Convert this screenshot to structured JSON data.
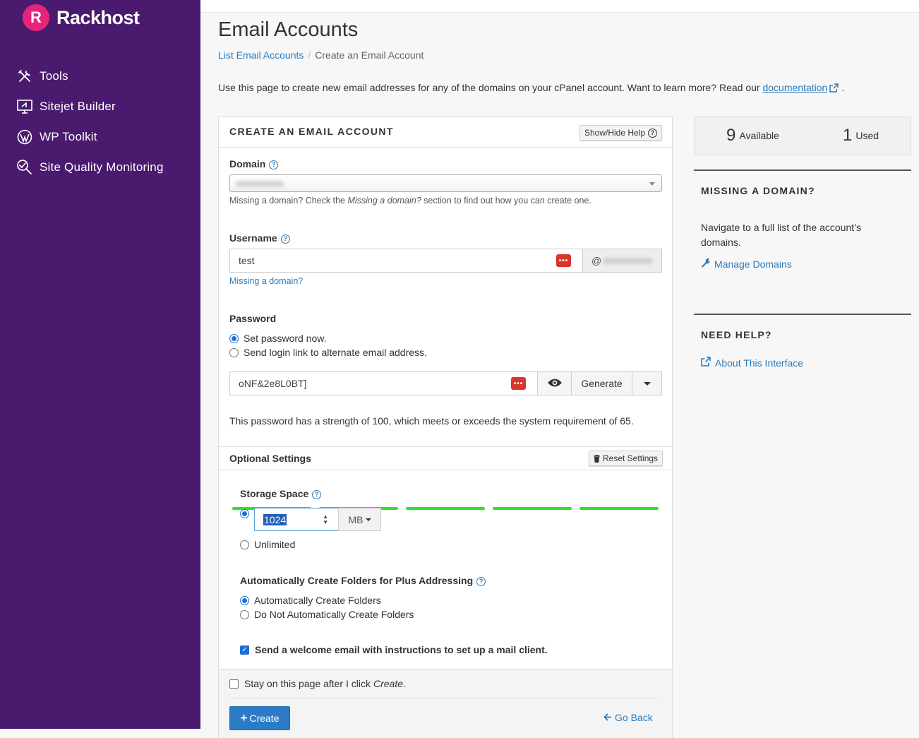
{
  "brand": {
    "mark": "R",
    "name": "Rackhost",
    "mark_color": "#e8247a",
    "sidebar_color": "#4a1a6e"
  },
  "nav": [
    {
      "label": "Tools",
      "icon": "tools-icon"
    },
    {
      "label": "Sitejet Builder",
      "icon": "sitejet-monitor-icon"
    },
    {
      "label": "WP Toolkit",
      "icon": "wordpress-icon"
    },
    {
      "label": "Site Quality Monitoring",
      "icon": "magnifier-icon"
    }
  ],
  "page": {
    "title": "Email Accounts",
    "breadcrumb": {
      "parent": "List Email Accounts",
      "current": "Create an Email Account"
    },
    "intro_text": "Use this page to create new email addresses for any of the domains on your cPanel account. Want to learn more? Read our",
    "intro_link": "documentation",
    "intro_end": "."
  },
  "form": {
    "title": "CREATE AN EMAIL ACCOUNT",
    "help_toggle": "Show/Hide Help",
    "domain": {
      "label": "Domain",
      "hint_prefix": "Missing a domain? Check the",
      "hint_em": "Missing a domain?",
      "hint_suffix": "section to find out how you can create one."
    },
    "username": {
      "label": "Username",
      "value": "test",
      "at": "@",
      "missing_link": "Missing a domain?"
    },
    "password": {
      "label": "Password",
      "option_now": "Set password now.",
      "option_link": "Send login link to alternate email address.",
      "value": "oNF&2e8L0BT]",
      "generate": "Generate",
      "strength_text": "This password has a strength of 100, which meets or exceeds the system requirement of 65.",
      "strength": 100,
      "strength_color": "#2ee02e"
    },
    "optional": {
      "title": "Optional Settings",
      "reset": "Reset Settings",
      "storage_label": "Storage Space",
      "storage_value": "1024",
      "storage_unit": "MB",
      "unlimited": "Unlimited",
      "plus_label": "Automatically Create Folders for Plus Addressing",
      "plus_auto": "Automatically Create Folders",
      "plus_no": "Do Not Automatically Create Folders",
      "welcome": "Send a welcome email with instructions to set up a mail client."
    },
    "footer": {
      "stay_prefix": "Stay on this page after I click",
      "stay_em": "Create",
      "stay_suffix": ".",
      "create": "Create",
      "go_back": "Go Back"
    }
  },
  "stats": {
    "available_num": "9",
    "available_label": "Available",
    "used_num": "1",
    "used_label": "Used"
  },
  "missing_domain": {
    "title": "MISSING A DOMAIN?",
    "text": "Navigate to a full list of the account’s domains.",
    "link": "Manage Domains"
  },
  "need_help": {
    "title": "NEED HELP?",
    "link": "About This Interface"
  },
  "colors": {
    "link": "#2a7bbd",
    "primary": "#2b7bc6",
    "radio": "#1d6fd1",
    "password_manager": "#d9352f"
  }
}
